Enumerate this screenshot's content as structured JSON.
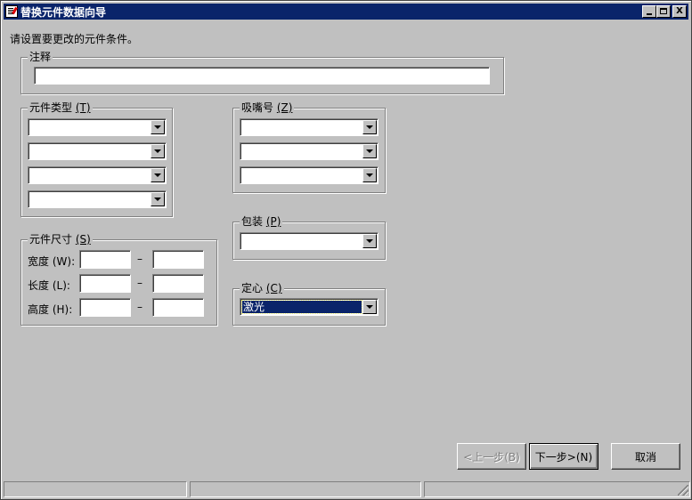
{
  "window": {
    "title": "替换元件数据向导",
    "minimize_label": "_",
    "maximize_label": "□",
    "close_label": "X"
  },
  "instruction": "请设置要更改的元件条件。",
  "comment": {
    "label": "注释",
    "value": ""
  },
  "component_type": {
    "label": "元件类型",
    "hotkey": "(T)",
    "combos": [
      "",
      "",
      "",
      ""
    ]
  },
  "nozzle": {
    "label": "吸嘴号",
    "hotkey": "(Z)",
    "combos": [
      "",
      "",
      ""
    ]
  },
  "package": {
    "label": "包装",
    "hotkey": "(P)",
    "value": ""
  },
  "centering": {
    "label": "定心",
    "hotkey": "(C)",
    "value": "激光"
  },
  "size": {
    "label": "元件尺寸",
    "hotkey": "(S)",
    "rows": [
      {
        "label": "宽度",
        "hotkey": "(W):",
        "separator": "–",
        "min": "",
        "max": ""
      },
      {
        "label": "长度",
        "hotkey": "(L):",
        "separator": "–",
        "min": "",
        "max": ""
      },
      {
        "label": "高度",
        "hotkey": "(H):",
        "separator": "–",
        "min": "",
        "max": ""
      }
    ]
  },
  "buttons": {
    "back": "<上一步(B)",
    "next": "下一步>(N)",
    "cancel": "取消"
  },
  "statusbar": {
    "panes": [
      "",
      "",
      ""
    ]
  }
}
